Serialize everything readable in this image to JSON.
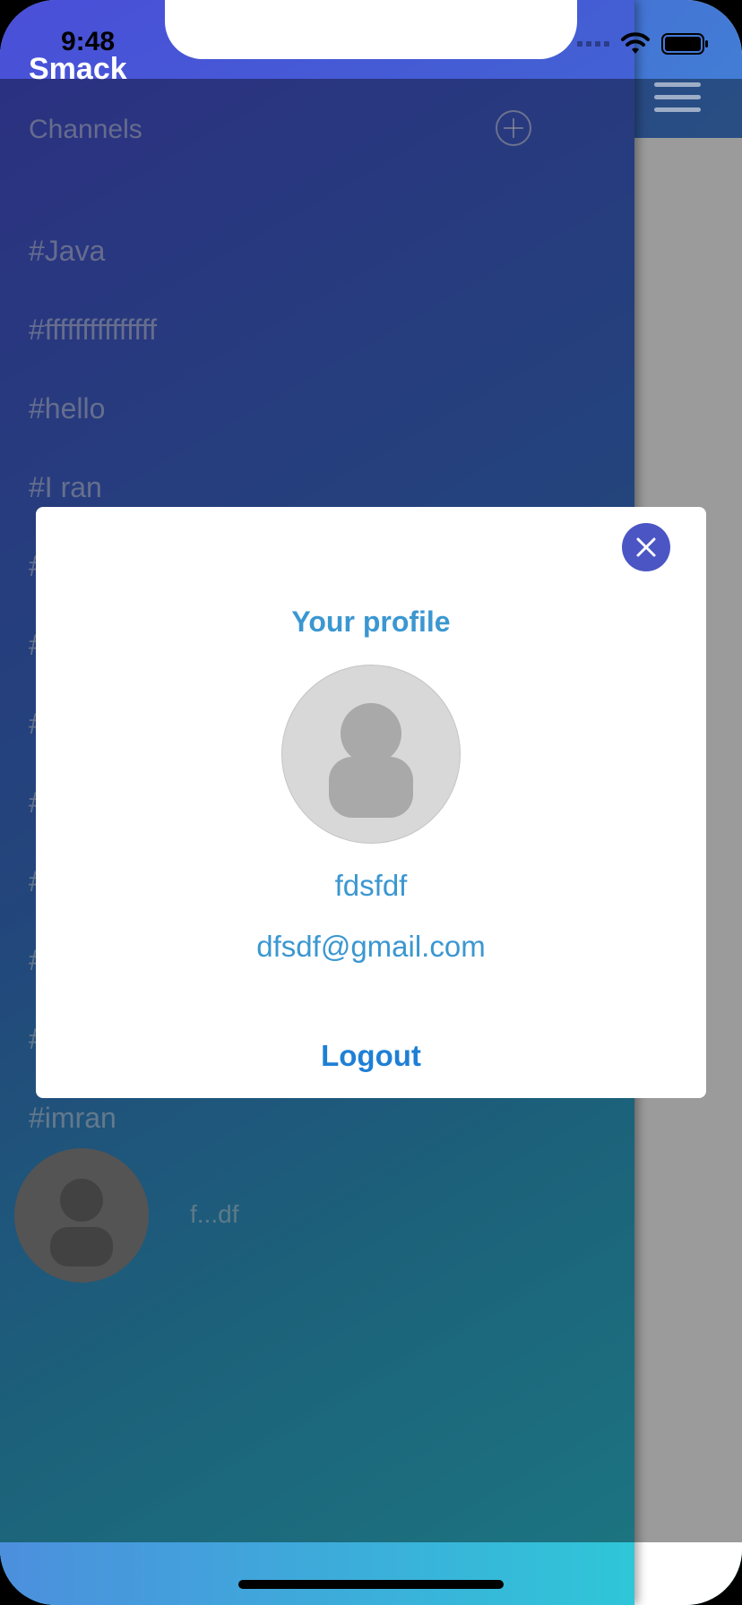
{
  "status_bar": {
    "time": "9:48"
  },
  "app": {
    "title": "Smack"
  },
  "drawer": {
    "channels_label": "Channels",
    "add_channel_icon": "plus-circle-icon",
    "channels": [
      "#Java",
      "#fffffffffffffff",
      "#hello",
      "#I ran",
      "#",
      "#",
      "#",
      "#",
      "#",
      "#",
      "#",
      "#imran"
    ],
    "user_name": "f...df"
  },
  "main": {
    "menu_icon": "hamburger-menu-icon"
  },
  "profile_modal": {
    "title": "Your profile",
    "name": "fdsfdf",
    "email": "dfsdf@gmail.com",
    "logout_label": "Logout",
    "close_icon": "close-icon"
  },
  "colors": {
    "accent": "#3b97d1",
    "close_button": "#4b56c4",
    "logout": "#1e7fd6"
  }
}
